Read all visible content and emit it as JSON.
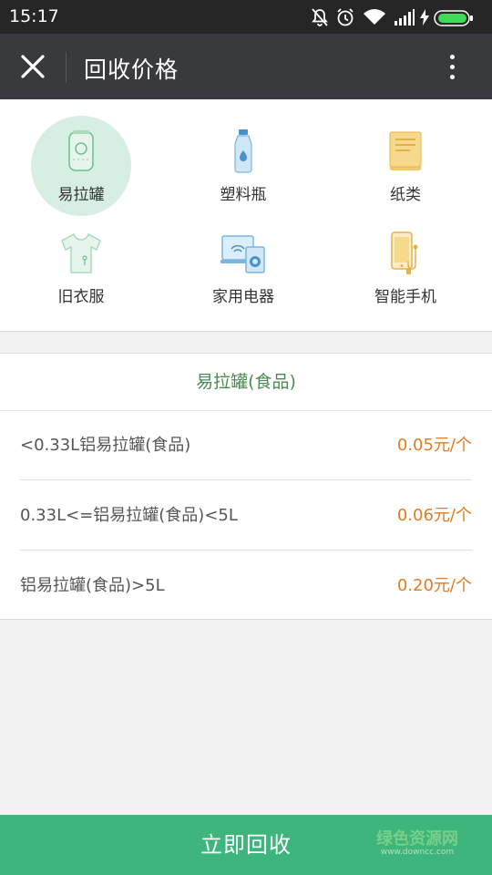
{
  "status_bar": {
    "time": "15:17",
    "icons": [
      "bell-off-icon",
      "alarm-icon",
      "wifi-icon",
      "signal-icon",
      "charging-icon",
      "battery-icon"
    ]
  },
  "header": {
    "title": "回收价格",
    "close_icon": "close-icon",
    "more_icon": "more-vertical-icon"
  },
  "categories": [
    {
      "label": "易拉罐",
      "icon": "can-icon",
      "active": true
    },
    {
      "label": "塑料瓶",
      "icon": "bottle-icon",
      "active": false
    },
    {
      "label": "纸类",
      "icon": "paper-icon",
      "active": false
    },
    {
      "label": "旧衣服",
      "icon": "clothes-icon",
      "active": false
    },
    {
      "label": "家用电器",
      "icon": "appliance-icon",
      "active": false
    },
    {
      "label": "智能手机",
      "icon": "smartphone-icon",
      "active": false
    }
  ],
  "price_list": {
    "heading": "易拉罐(食品)",
    "rows": [
      {
        "label": "<0.33L铝易拉罐(食品)",
        "price": "0.05元/个"
      },
      {
        "label": "0.33L<=铝易拉罐(食品)<5L",
        "price": "0.06元/个"
      },
      {
        "label": "铝易拉罐(食品)>5L",
        "price": "0.20元/个"
      }
    ]
  },
  "action_button": {
    "label": "立即回收"
  },
  "watermark": {
    "text": "绿色资源网",
    "url": "www.downcc.com"
  },
  "colors": {
    "status_bar": "#262626",
    "header": "#393a3e",
    "accent_green": "#3db57c",
    "heading_green": "#4a8a52",
    "price_orange": "#e07c22",
    "active_circle": "#d7efe2"
  }
}
